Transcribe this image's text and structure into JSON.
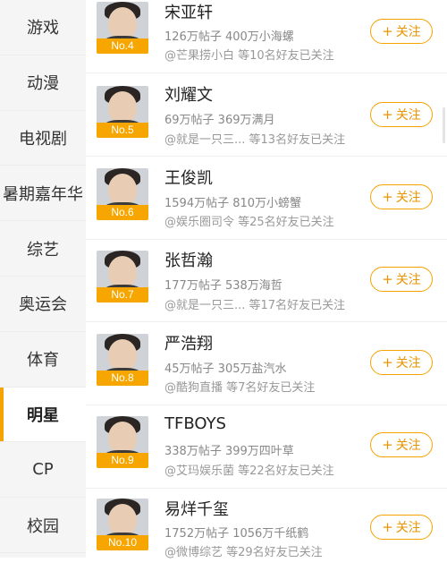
{
  "sidebar": {
    "items": [
      {
        "label": "游戏"
      },
      {
        "label": "动漫"
      },
      {
        "label": "电视剧"
      },
      {
        "label": "暑期嘉年华"
      },
      {
        "label": "综艺"
      },
      {
        "label": "奥运会"
      },
      {
        "label": "体育"
      },
      {
        "label": "明星",
        "active": true
      },
      {
        "label": "CP"
      },
      {
        "label": "校园"
      }
    ]
  },
  "follow_button": {
    "plus": "+",
    "label": "关注"
  },
  "accent_color": "#f5a300",
  "rows": [
    {
      "rank": "No.4",
      "name": "宋亚轩",
      "stats": "126万帖子 400万小海螺",
      "follow": "@芒果捞小白 等10名好友已关注"
    },
    {
      "rank": "No.5",
      "name": "刘耀文",
      "stats": "69万帖子 369万满月",
      "follow": "@就是一只三... 等13名好友已关注"
    },
    {
      "rank": "No.6",
      "name": "王俊凯",
      "stats": "1594万帖子 810万小螃蟹",
      "follow": "@娱乐圈司令 等25名好友已关注"
    },
    {
      "rank": "No.7",
      "name": "张哲瀚",
      "stats": "177万帖子 538万海哲",
      "follow": "@就是一只三... 等17名好友已关注"
    },
    {
      "rank": "No.8",
      "name": "严浩翔",
      "stats": "45万帖子 305万盐汽水",
      "follow": "@酷狗直播 等7名好友已关注"
    },
    {
      "rank": "No.9",
      "name": "TFBOYS",
      "stats": "338万帖子 399万四叶草",
      "follow": "@艾玛娱乐菌 等22名好友已关注"
    },
    {
      "rank": "No.10",
      "name": "易烊千玺",
      "stats": "1752万帖子 1056万千纸鹤",
      "follow": "@微博综艺 等29名好友已关注"
    }
  ]
}
